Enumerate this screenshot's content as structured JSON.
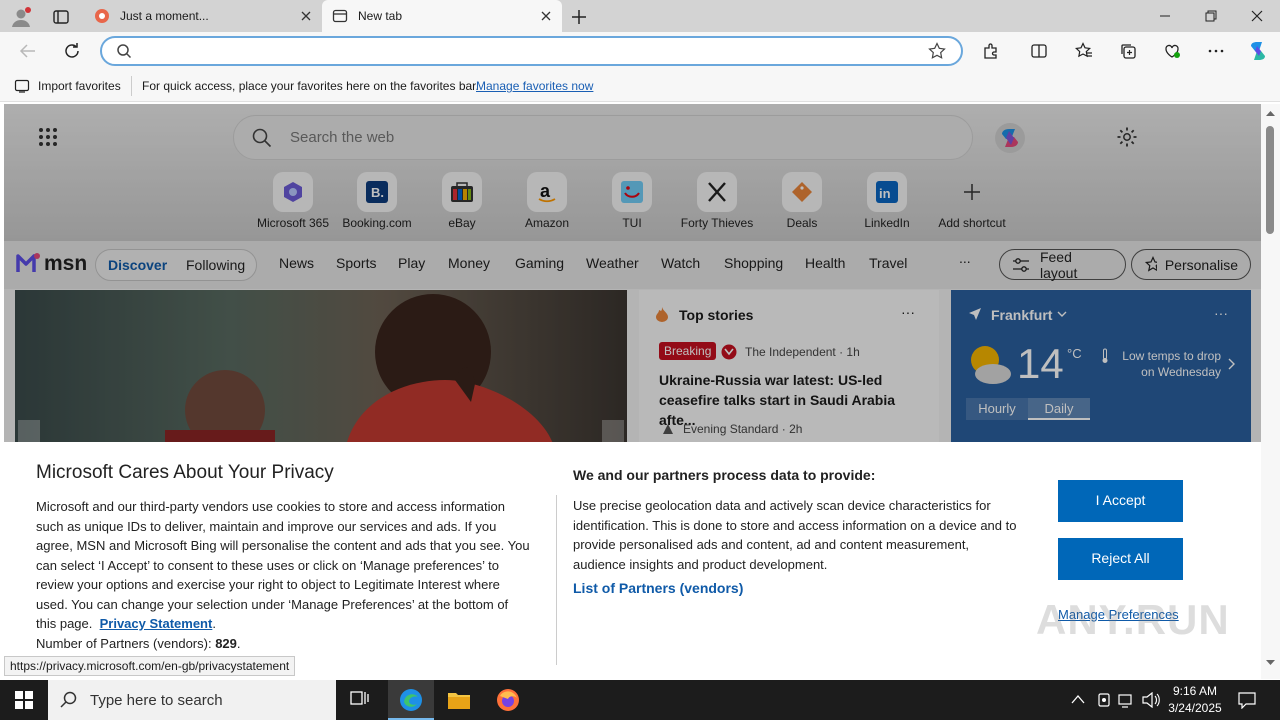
{
  "browser": {
    "tabs": [
      {
        "title": "Just a moment...",
        "active": false
      },
      {
        "title": "New tab",
        "active": true
      }
    ],
    "address": {
      "value": "",
      "placeholder": ""
    },
    "favorites_bar": {
      "import_label": "Import favorites",
      "hint": "For quick access, place your favorites here on the favorites bar.",
      "manage_link": "Manage favorites now"
    },
    "status_url": "https://privacy.microsoft.com/en-gb/privacystatement"
  },
  "newtab": {
    "search_placeholder": "Search the web",
    "shortcuts": [
      {
        "label": "Microsoft 365",
        "icon": "m365-icon"
      },
      {
        "label": "Booking.com",
        "icon": "booking-icon"
      },
      {
        "label": "eBay",
        "icon": "ebay-icon"
      },
      {
        "label": "Amazon",
        "icon": "amazon-icon"
      },
      {
        "label": "TUI",
        "icon": "tui-icon"
      },
      {
        "label": "Forty Thieves",
        "icon": "forty-thieves-icon"
      },
      {
        "label": "Deals",
        "icon": "deals-icon"
      },
      {
        "label": "LinkedIn",
        "icon": "linkedin-icon"
      },
      {
        "label": "Add shortcut",
        "icon": "plus-icon"
      }
    ],
    "msn": {
      "logo": "msn",
      "tabs": [
        "Discover",
        "Following"
      ],
      "nav": [
        "News",
        "Sports",
        "Play",
        "Money",
        "Gaming",
        "Weather",
        "Watch",
        "Shopping",
        "Health",
        "Travel"
      ],
      "more": "...",
      "feed_layout": "Feed layout",
      "personalise": "Personalise"
    },
    "top_stories": {
      "title": "Top stories",
      "badge": "Breaking",
      "source1": "The Independent · 1h",
      "headline": "Ukraine-Russia war latest: US-led ceasefire talks start in Saudi Arabia afte...",
      "source2": "Evening Standard · 2h"
    },
    "weather": {
      "city": "Frankfurt",
      "temp": "14",
      "unit": "°C",
      "note_line1": "Low temps to drop",
      "note_line2": "on Wednesday",
      "tabs": [
        "Hourly",
        "Daily"
      ]
    }
  },
  "cookie": {
    "title": "Microsoft Cares About Your Privacy",
    "body_lines": [
      "Microsoft and our third-party vendors use cookies to store and access information",
      "such as unique IDs to deliver, maintain and improve our services and ads. If you",
      "agree, MSN and Microsoft Bing will personalise the content and ads that you see. You",
      "can select ‘I Accept’ to consent to these uses or click on ‘Manage preferences’ to",
      "review your options and exercise your right to object to Legitimate Interest where",
      "used.  You can change your selection under ‘Manage Preferences’ at the bottom of",
      "this page."
    ],
    "privacy_link": "Privacy Statement",
    "partners_label": "Number of Partners (vendors):",
    "partners_count": "829",
    "right_title": "We and our partners process data to provide:",
    "right_lines": [
      "Use precise geolocation data and actively scan device characteristics for",
      "identification. This is done to store and access information on a device and to",
      "provide personalised ads and content, ad and content measurement,",
      "audience insights and product development."
    ],
    "vendors_link": "List of Partners (vendors)",
    "accept": "I Accept",
    "reject": "Reject All",
    "manage": "Manage Preferences"
  },
  "taskbar": {
    "search_placeholder": "Type here to search",
    "time": "9:16 AM",
    "date": "3/24/2025"
  },
  "watermark": "ANY.RUN",
  "colors": {
    "accent": "#0067b8",
    "breaking": "#c50f1f",
    "weather_bg": "#2a5f9e"
  }
}
